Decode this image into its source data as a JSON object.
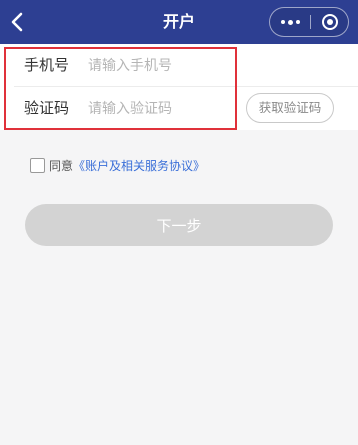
{
  "navbar": {
    "title": "开户",
    "back_icon": "chevron-left-icon",
    "more_icon": "more-dots-icon",
    "close_icon": "target-close-icon",
    "background": "#2d3f92"
  },
  "form": {
    "phone": {
      "label": "手机号",
      "placeholder": "请输入手机号",
      "value": ""
    },
    "code": {
      "label": "验证码",
      "placeholder": "请输入验证码",
      "value": ""
    },
    "get_code_label": "获取验证码"
  },
  "agreement": {
    "prefix": "同意",
    "link": "《账户及相关服务协议》",
    "checked": false
  },
  "next_button": {
    "label": "下一步",
    "disabled": true
  },
  "colors": {
    "highlight_border": "#e0313a",
    "link": "#3a6fd8",
    "disabled_button": "#d3d3d3"
  }
}
